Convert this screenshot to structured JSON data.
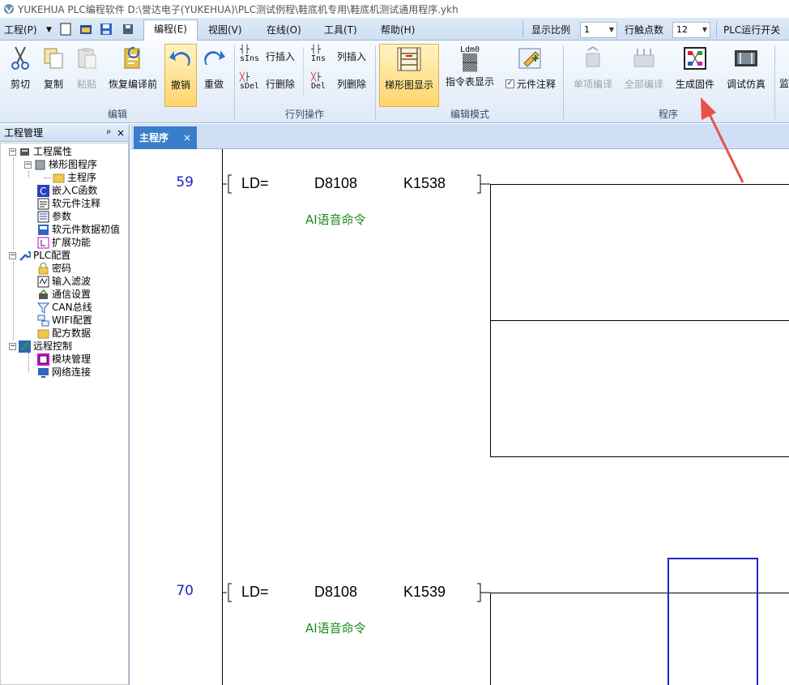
{
  "window": {
    "title": "YUKEHUA PLC编程软件 D:\\誉达电子(YUKEHUA)\\PLC测试例程\\鞋底机专用\\鞋底机测试通用程序.ykh"
  },
  "menu": {
    "project": "工程(P)",
    "edit": "编程(E)",
    "view": "视图(V)",
    "online": "在线(O)",
    "tools": "工具(T)",
    "help": "帮助(H)",
    "scale_label": "显示比例",
    "scale_value": "1",
    "contacts_label": "行触点数",
    "contacts_value": "12",
    "plc_run": "PLC运行开关"
  },
  "ribbon": {
    "cut": "剪切",
    "copy": "复制",
    "paste": "粘贴",
    "restore": "恢复编译前",
    "undo": "撤销",
    "redo": "重做",
    "row_insert": "行插入",
    "row_delete": "行删除",
    "col_insert": "列插入",
    "col_delete": "列删除",
    "ladder_view": "梯形图显示",
    "instr_view": "指令表显示",
    "elem_comment": "元件注释",
    "single_compile": "单项编译",
    "full_compile": "全部编译",
    "gen_firmware": "生成固件",
    "debug_sim": "调试仿真",
    "monitor_partial": "监",
    "group_edit": "编辑",
    "group_rowcol": "行列操作",
    "group_mode": "编辑模式",
    "group_program": "程序",
    "icon_sins": "sIns",
    "icon_sdel": "sDel",
    "icon_ins": "Ins",
    "icon_del": "Del",
    "icon_ldm": "Ldm0"
  },
  "project_panel": {
    "title": "工程管理",
    "pin": "ᵖ",
    "close": "×",
    "items": [
      {
        "label": "工程属性"
      },
      {
        "label": "梯形图程序"
      },
      {
        "label": "主程序"
      },
      {
        "label": "嵌入C函数"
      },
      {
        "label": "软元件注释"
      },
      {
        "label": "参数"
      },
      {
        "label": "软元件数据初值"
      },
      {
        "label": "扩展功能"
      },
      {
        "label": "PLC配置"
      },
      {
        "label": "密码"
      },
      {
        "label": "输入滤波"
      },
      {
        "label": "通信设置"
      },
      {
        "label": "CAN总线"
      },
      {
        "label": "WIFI配置"
      },
      {
        "label": "配方数据"
      },
      {
        "label": "远程控制"
      },
      {
        "label": "模块管理"
      },
      {
        "label": "网络连接"
      }
    ]
  },
  "editor": {
    "tab_label": "主程序",
    "tab_close": "×",
    "rungs": [
      {
        "line": "59",
        "op": "LD=",
        "arg1": "D8108",
        "arg2": "K1538",
        "comment": "AI语音命令"
      },
      {
        "line": "70",
        "op": "LD=",
        "arg1": "D8108",
        "arg2": "K1539",
        "comment": "AI语音命令"
      }
    ]
  },
  "colors": {
    "accent": "#3a7dc9",
    "line_num": "#2323c8",
    "comment": "#1e8a1e",
    "arrow": "#e8504a"
  }
}
